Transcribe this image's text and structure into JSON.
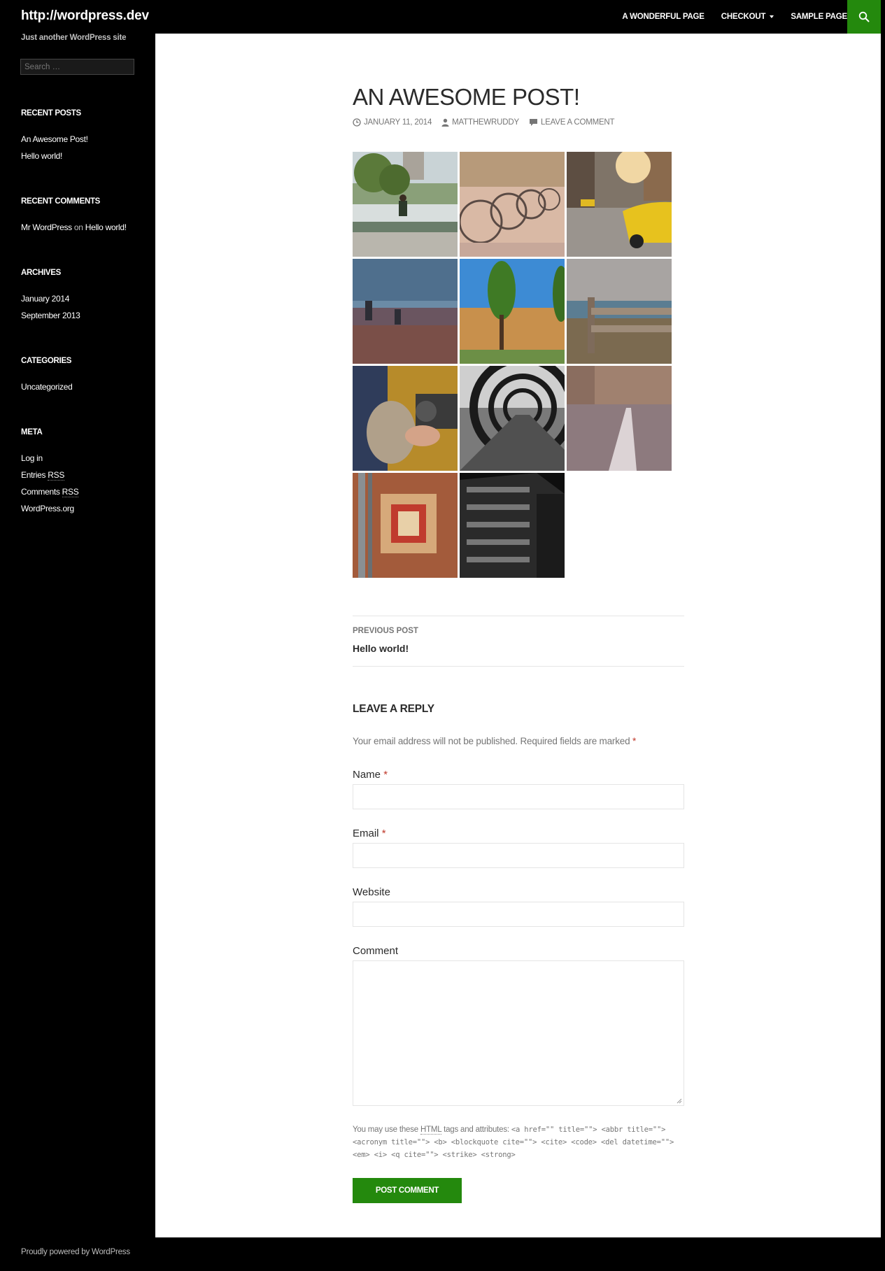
{
  "header": {
    "site_title": "http://wordpress.dev",
    "nav": [
      {
        "label": "A Wonderful Page"
      },
      {
        "label": "Checkout"
      },
      {
        "label": "Sample Page"
      }
    ]
  },
  "sidebar": {
    "tagline": "Just another WordPress site",
    "search_placeholder": "Search …",
    "recent_posts": {
      "title": "Recent Posts",
      "items": [
        "An Awesome Post!",
        "Hello world!"
      ]
    },
    "recent_comments": {
      "title": "Recent Comments",
      "author": "Mr WordPress",
      "on": "on",
      "post": "Hello world!"
    },
    "archives": {
      "title": "Archives",
      "items": [
        "January 2014",
        "September 2013"
      ]
    },
    "categories": {
      "title": "Categories",
      "items": [
        "Uncategorized"
      ]
    },
    "meta": {
      "title": "Meta",
      "login": "Log in",
      "entries": "Entries",
      "comments": "Comments",
      "rss": "RSS",
      "wordpress_org": "WordPress.org"
    }
  },
  "post": {
    "title": "An Awesome Post!",
    "date": "January 11, 2014",
    "author": "matthewruddy",
    "comment_link": "Leave a comment"
  },
  "post_nav": {
    "label": "Previous Post",
    "link": "Hello world!"
  },
  "reply": {
    "title": "Leave a Reply",
    "notes": "Your email address will not be published. Required fields are marked",
    "required_mark": "*",
    "name_label": "Name",
    "email_label": "Email",
    "website_label": "Website",
    "comment_label": "Comment",
    "allowed_prefix": "You may use these",
    "allowed_html": "HTML",
    "allowed_suffix": "tags and attributes:",
    "allowed_tags": "<a href=\"\" title=\"\"> <abbr title=\"\"> <acronym title=\"\"> <b> <blockquote cite=\"\"> <cite> <code> <del datetime=\"\"> <em> <i> <q cite=\"\"> <strike> <strong>",
    "submit_label": "Post Comment"
  },
  "footer": {
    "text": "Proudly powered by WordPress"
  },
  "colors": {
    "accent": "#24890d",
    "header_bg": "#000000",
    "required": "#c0392b"
  }
}
